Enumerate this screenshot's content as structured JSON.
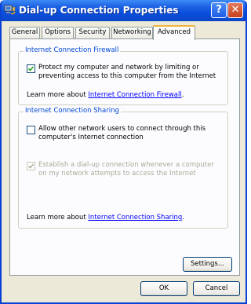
{
  "window": {
    "title": "Dial-up Connection Properties",
    "help_btn": "?",
    "close_btn": "✕"
  },
  "tabs": [
    {
      "label": "General",
      "active": false
    },
    {
      "label": "Options",
      "active": false
    },
    {
      "label": "Security",
      "active": false
    },
    {
      "label": "Networking",
      "active": false
    },
    {
      "label": "Advanced",
      "active": true
    }
  ],
  "firewall": {
    "title": "Internet Connection Firewall",
    "checkbox_label": "Protect my computer and network by limiting or preventing access to this computer from the Internet",
    "checked": true,
    "learn_prefix": "Learn more about ",
    "learn_link": "Internet Connection Firewall",
    "learn_suffix": "."
  },
  "sharing": {
    "title": "Internet Connection Sharing",
    "allow_label": "Allow other network users to connect through this computer's Internet connection",
    "allow_checked": false,
    "dial_label": "Establish a dial-up connection whenever a computer on my network attempts to access the Internet",
    "dial_checked": true,
    "dial_disabled": true,
    "learn_prefix": "Learn more about ",
    "learn_link": "Internet Connection Sharing",
    "learn_suffix": "."
  },
  "buttons": {
    "settings": "Settings...",
    "ok": "OK",
    "cancel": "Cancel"
  },
  "colors": {
    "title_bar": "#0a4fdc",
    "group_title": "#0046d5",
    "link": "#0000ff",
    "tab_highlight": "#f2b33c"
  }
}
